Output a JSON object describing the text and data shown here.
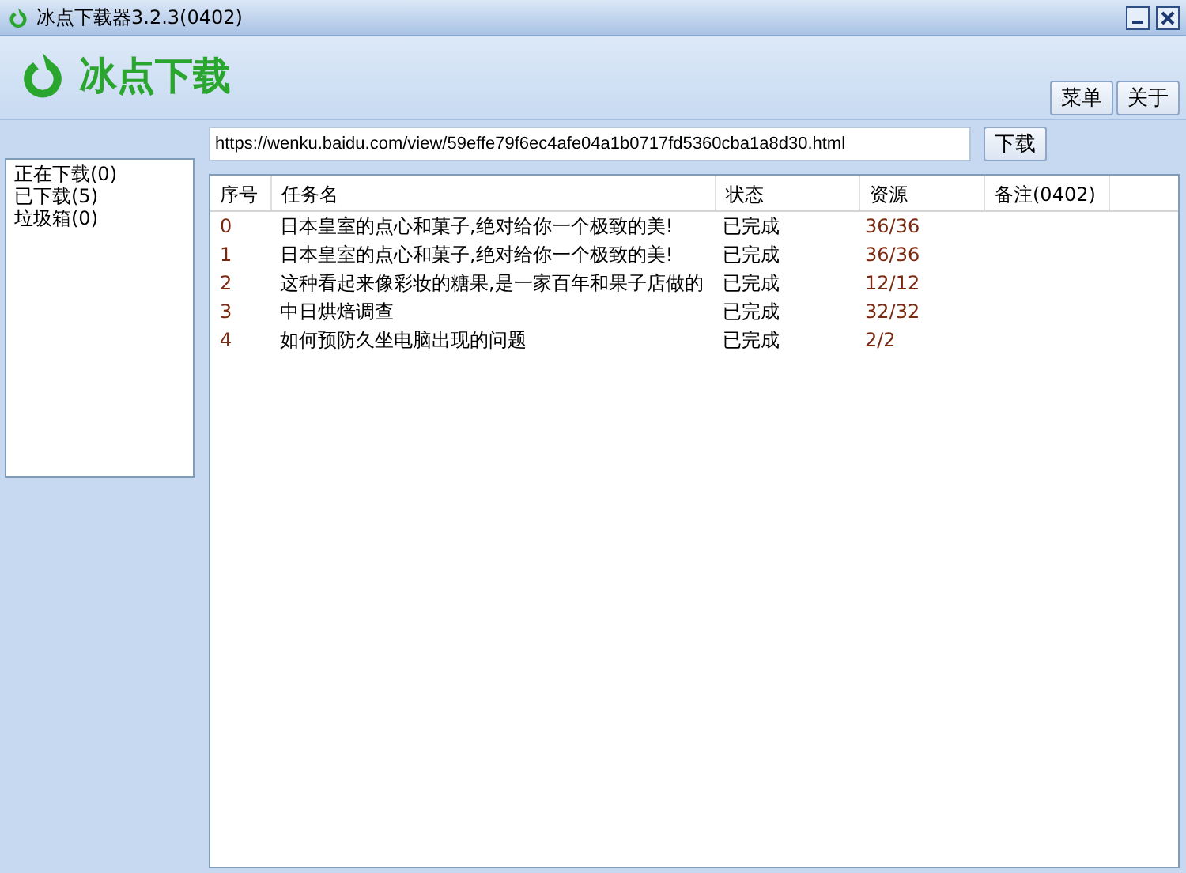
{
  "window": {
    "title": "冰点下载器3.2.3(0402)"
  },
  "header": {
    "logo_text": "冰点下载",
    "buttons": [
      "菜单",
      "关于"
    ]
  },
  "url_bar": {
    "value": "https://wenku.baidu.com/view/59effe79f6ec4afe04a1b0717fd5360cba1a8d30.html",
    "button": "下载"
  },
  "sidebar": {
    "items": [
      {
        "label": "正在下载(0)"
      },
      {
        "label": "已下载(5)"
      },
      {
        "label": "垃圾箱(0)"
      }
    ]
  },
  "table": {
    "columns": [
      "序号",
      "任务名",
      "状态",
      "资源",
      "备注(0402)"
    ],
    "rows": [
      [
        "0",
        "日本皇室的点心和菓子,绝对给你一个极致的美!",
        "已完成",
        "36/36"
      ],
      [
        "1",
        "日本皇室的点心和菓子,绝对给你一个极致的美!",
        "已完成",
        "36/36"
      ],
      [
        "2",
        "这种看起来像彩妆的糖果,是一家百年和果子店做的",
        "已完成",
        "12/12"
      ],
      [
        "3",
        "中日烘焙调查",
        "已完成",
        "32/32"
      ],
      [
        "4",
        "如何预防久坐电脑出现的问题",
        "已完成",
        "2/2"
      ]
    ]
  }
}
